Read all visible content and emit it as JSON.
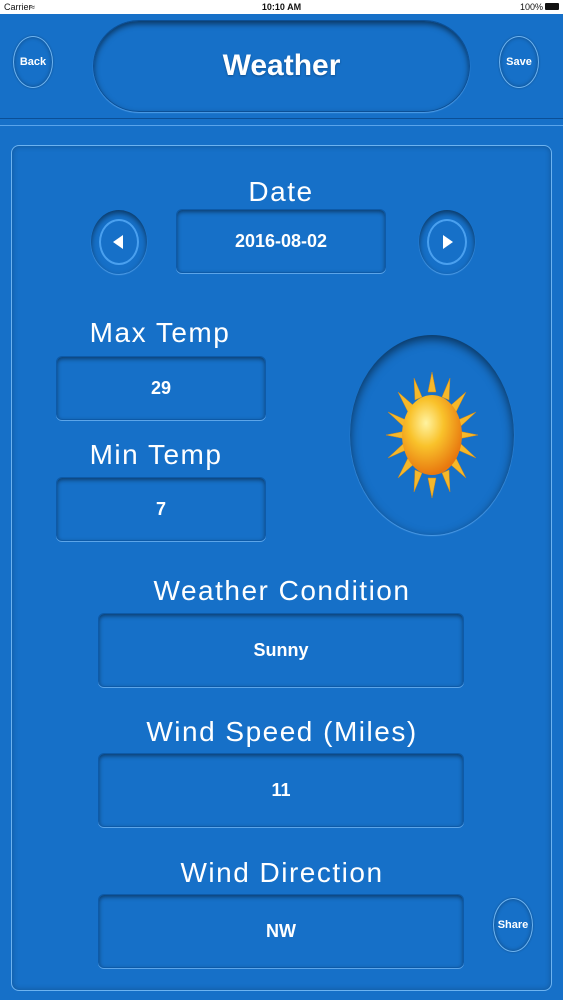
{
  "status_bar": {
    "carrier": "Carrier",
    "time": "10:10 AM",
    "battery": "100%"
  },
  "header": {
    "back_label": "Back",
    "title": "Weather",
    "save_label": "Save"
  },
  "date": {
    "label": "Date",
    "value": "2016-08-02"
  },
  "max_temp": {
    "label": "Max Temp",
    "value": "29"
  },
  "min_temp": {
    "label": "Min Temp",
    "value": "7"
  },
  "condition_icon": "sun-icon",
  "weather_condition": {
    "label": "Weather Condition",
    "value": "Sunny"
  },
  "wind_speed": {
    "label": "Wind Speed (Miles)",
    "value": "11"
  },
  "wind_direction": {
    "label": "Wind Direction",
    "value": "NW"
  },
  "share_label": "Share",
  "colors": {
    "background": "#1670c8",
    "sun_core": "#f7a51d",
    "sun_rays": "#f5b82a"
  }
}
